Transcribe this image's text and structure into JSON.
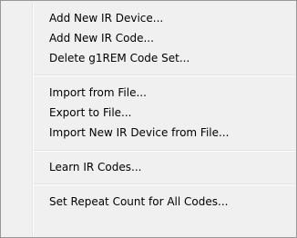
{
  "context_menu": {
    "groups": [
      {
        "items": [
          {
            "label": "Add New IR Device..."
          },
          {
            "label": "Add New IR Code..."
          },
          {
            "label": "Delete g1REM Code Set..."
          }
        ]
      },
      {
        "items": [
          {
            "label": "Import from File..."
          },
          {
            "label": "Export to File..."
          },
          {
            "label": "Import New IR Device from File..."
          }
        ]
      },
      {
        "items": [
          {
            "label": "Learn IR Codes..."
          }
        ]
      },
      {
        "items": [
          {
            "label": "Set Repeat Count for All Codes..."
          }
        ]
      }
    ]
  }
}
